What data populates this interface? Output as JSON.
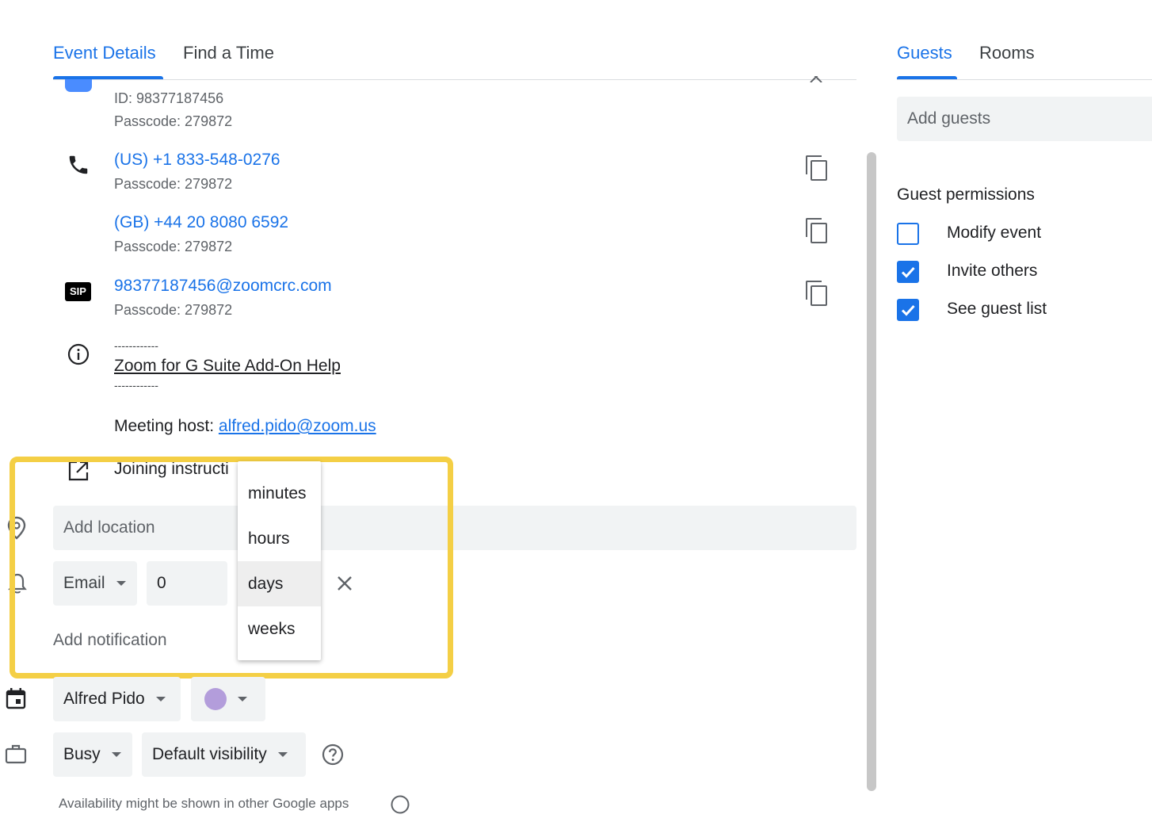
{
  "tabs_left": {
    "event_details": "Event Details",
    "find_a_time": "Find a Time"
  },
  "tabs_right": {
    "guests": "Guests",
    "rooms": "Rooms"
  },
  "conference": {
    "id_text": "ID: 98377187456",
    "passcode_1": "Passcode: 279872",
    "phone_us": "(US) +1 833-548-0276",
    "passcode_2": "Passcode: 279872",
    "phone_gb": "(GB) +44 20 8080 6592",
    "passcode_3": "Passcode: 279872",
    "sip_badge": "SIP",
    "sip_address": "98377187456@zoomcrc.com",
    "passcode_4": "Passcode: 279872",
    "dashes_top": "------------",
    "help_link": "Zoom for G Suite Add-On Help",
    "dashes_bottom": "------------",
    "host_label": "Meeting host: ",
    "host_email": "alfred.pido@zoom.us",
    "joining_instructions": "Joining instructi"
  },
  "location": {
    "placeholder": "Add location"
  },
  "notification": {
    "method": "Email",
    "value": "0",
    "add_label": "Add notification"
  },
  "unit_menu": {
    "options": [
      "minutes",
      "hours",
      "days",
      "weeks"
    ],
    "selected": "days"
  },
  "calendar": {
    "owner": "Alfred Pido",
    "color": "#b39ddb"
  },
  "availability": {
    "status": "Busy",
    "visibility": "Default visibility",
    "note": "Availability might be shown in other Google apps"
  },
  "guests": {
    "add_placeholder": "Add guests",
    "permissions_title": "Guest permissions",
    "permissions": [
      {
        "label": "Modify event",
        "checked": false
      },
      {
        "label": "Invite others",
        "checked": true
      },
      {
        "label": "See guest list",
        "checked": true
      }
    ]
  },
  "colors": {
    "accent": "#1a73e8",
    "highlight": "#f4cf45",
    "field_bg": "#f1f3f4"
  }
}
